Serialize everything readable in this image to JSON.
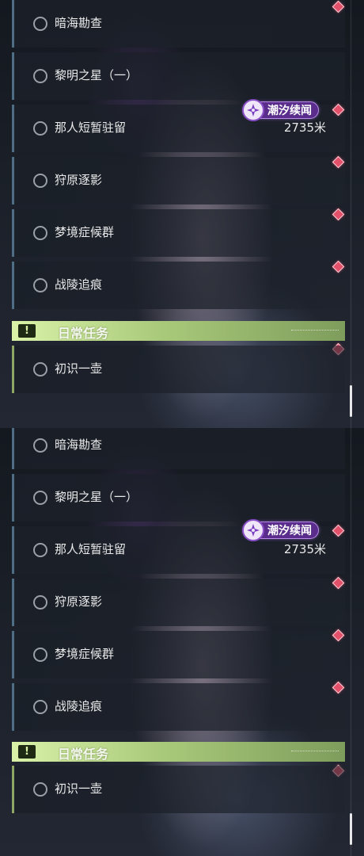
{
  "panels": [
    {
      "quests": [
        {
          "label": "暗海勘查"
        },
        {
          "label": "黎明之星（一）"
        },
        {
          "label": "那人短暂驻留",
          "distance": "2735米"
        },
        {
          "label": "狩原逐影"
        },
        {
          "label": "梦境症候群"
        },
        {
          "label": "战陵追痕"
        }
      ],
      "badge": {
        "label": "潮汐续闻"
      },
      "section": {
        "title": "日常任务",
        "icon": "exclamation-icon"
      },
      "daily": [
        {
          "label": "初识一壶"
        }
      ]
    },
    {
      "quests": [
        {
          "label": "暗海勘查"
        },
        {
          "label": "黎明之星（一）"
        },
        {
          "label": "那人短暂驻留",
          "distance": "2735米"
        },
        {
          "label": "狩原逐影"
        },
        {
          "label": "梦境症候群"
        },
        {
          "label": "战陵追痕"
        }
      ],
      "badge": {
        "label": "潮汐续闻"
      },
      "section": {
        "title": "日常任务",
        "icon": "exclamation-icon"
      },
      "daily": [
        {
          "label": "初识一壶"
        }
      ]
    }
  ],
  "colors": {
    "quest_accent": "#4d6e85",
    "daily_accent": "#8ea765",
    "marker": "#e2506a",
    "badge": "#5a2d8c"
  }
}
